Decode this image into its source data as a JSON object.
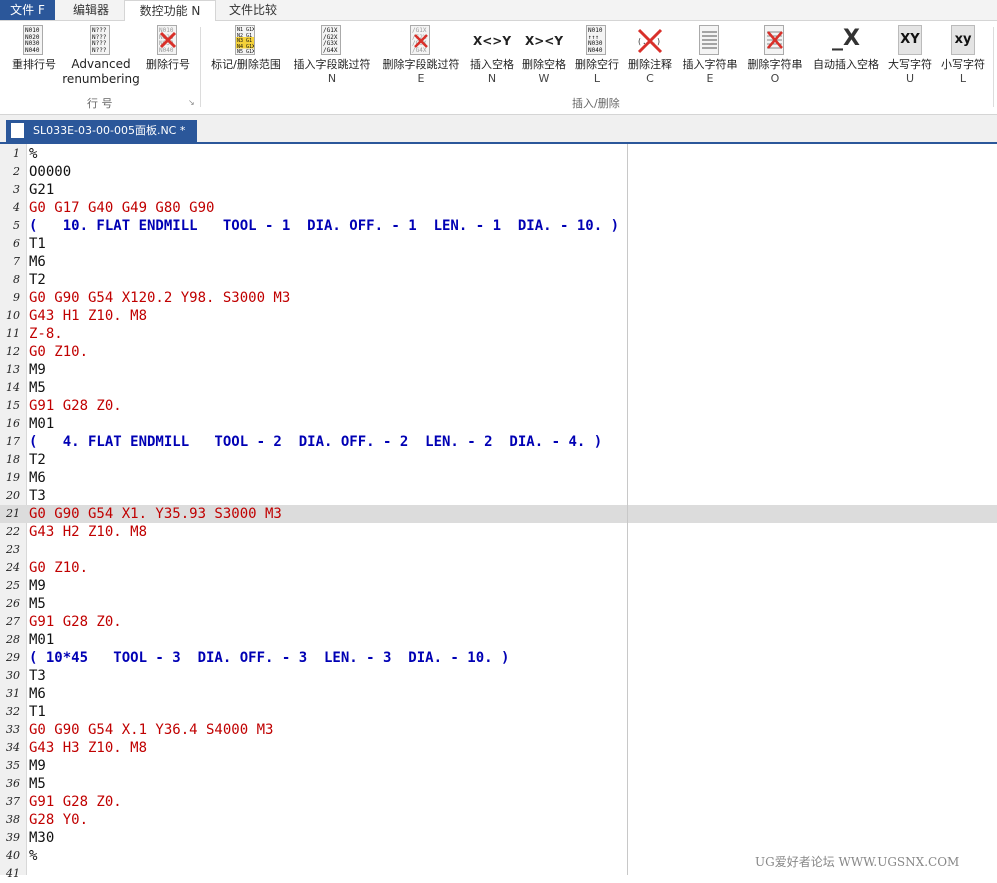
{
  "menubar": {
    "file_label": "文件 F",
    "tabs": [
      "编辑器",
      "数控功能 N",
      "文件比较"
    ]
  },
  "ribbon": {
    "group_line_label": "行 号",
    "group_insert_label": "插入/删除",
    "buttons": [
      {
        "label": "重排行号",
        "key": "",
        "icon": "renumber-icon",
        "icon_text": "N010\nN020\nN030\nN040"
      },
      {
        "label": "Advanced",
        "label2": "renumbering",
        "key": "",
        "icon": "advanced-renumber-icon",
        "icon_text": "N???\nN???\nN???\nN???"
      },
      {
        "label": "删除行号",
        "key": "",
        "icon": "delete-line-number-icon",
        "icon_text": "N010\nN020\nN030\nN040"
      },
      {
        "label": "标记/删除范围",
        "key": "",
        "icon": "mark-range-icon",
        "icon_text": "N1 G1X\nN2 G1\nN3 G1\nN4 G1X\nN5 G1X"
      },
      {
        "label": "插入字段跳过符",
        "key": "N",
        "icon": "insert-block-skip-icon",
        "icon_text": "/G1X\n/G2X\n/G3X\n/G4X"
      },
      {
        "label": "删除字段跳过符",
        "key": "E",
        "icon": "delete-block-skip-icon",
        "icon_text": "/G1X\n/G2X\n/G3X\n/G4X"
      },
      {
        "label": "插入空格",
        "key": "N",
        "icon": "insert-spaces-icon",
        "icon_text": "X<>Y"
      },
      {
        "label": "删除空格",
        "key": "W",
        "icon": "delete-spaces-icon",
        "icon_text": "X><Y"
      },
      {
        "label": "删除空行",
        "key": "L",
        "icon": "delete-empty-lines-icon",
        "icon_text": "N010\n↑↑↑\nN030\nN040"
      },
      {
        "label": "删除注释",
        "key": "C",
        "icon": "delete-comments-icon",
        "icon_text": "(...)"
      },
      {
        "label": "插入字符串",
        "key": "E",
        "icon": "insert-string-icon",
        "icon_text": "STRING"
      },
      {
        "label": "删除字符串",
        "key": "O",
        "icon": "delete-string-icon",
        "icon_text": "STRING"
      },
      {
        "label": "自动插入空格",
        "key": "",
        "icon": "auto-insert-space-icon",
        "icon_text": "_X"
      },
      {
        "label": "大写字符",
        "key": "U",
        "icon": "uppercase-icon",
        "icon_text": "XY"
      },
      {
        "label": "小写字符",
        "key": "L",
        "icon": "lowercase-icon",
        "icon_text": "xy"
      }
    ]
  },
  "editor_tab": {
    "title": "SL033E-03-00-005面板.NC *"
  },
  "highlighted_line": 21,
  "lines": [
    {
      "n": "1",
      "t": "%",
      "c": "black"
    },
    {
      "n": "2",
      "t": "O0000",
      "c": "black"
    },
    {
      "n": "3",
      "t": "G21",
      "c": "black"
    },
    {
      "n": "4",
      "t": "G0 G17 G40 G49 G80 G90",
      "c": "red"
    },
    {
      "n": "5",
      "t": "(   10. FLAT ENDMILL   TOOL - 1  DIA. OFF. - 1  LEN. - 1  DIA. - 10. )",
      "c": "blue"
    },
    {
      "n": "6",
      "t": "T1",
      "c": "black"
    },
    {
      "n": "7",
      "t": "M6",
      "c": "black"
    },
    {
      "n": "8",
      "t": "T2",
      "c": "black"
    },
    {
      "n": "9",
      "t": "G0 G90 G54 X120.2 Y98. S3000 M3",
      "c": "red"
    },
    {
      "n": "10",
      "t": "G43 H1 Z10. M8",
      "c": "red"
    },
    {
      "n": "11",
      "t": "Z-8.",
      "c": "red"
    },
    {
      "n": "12",
      "t": "G0 Z10.",
      "c": "red"
    },
    {
      "n": "13",
      "t": "M9",
      "c": "black"
    },
    {
      "n": "14",
      "t": "M5",
      "c": "black"
    },
    {
      "n": "15",
      "t": "G91 G28 Z0.",
      "c": "red"
    },
    {
      "n": "16",
      "t": "M01",
      "c": "black"
    },
    {
      "n": "17",
      "t": "(   4. FLAT ENDMILL   TOOL - 2  DIA. OFF. - 2  LEN. - 2  DIA. - 4. )",
      "c": "blue"
    },
    {
      "n": "18",
      "t": "T2",
      "c": "black"
    },
    {
      "n": "19",
      "t": "M6",
      "c": "black"
    },
    {
      "n": "20",
      "t": "T3",
      "c": "black"
    },
    {
      "n": "21",
      "t": "G0 G90 G54 X1. Y35.93 S3000 M3",
      "c": "red"
    },
    {
      "n": "22",
      "t": "G43 H2 Z10. M8",
      "c": "red"
    },
    {
      "n": "23",
      "t": "",
      "c": "black"
    },
    {
      "n": "24",
      "t": "G0 Z10.",
      "c": "red"
    },
    {
      "n": "25",
      "t": "M9",
      "c": "black"
    },
    {
      "n": "26",
      "t": "M5",
      "c": "black"
    },
    {
      "n": "27",
      "t": "G91 G28 Z0.",
      "c": "red"
    },
    {
      "n": "28",
      "t": "M01",
      "c": "black"
    },
    {
      "n": "29",
      "t": "( 10*45   TOOL - 3  DIA. OFF. - 3  LEN. - 3  DIA. - 10. )",
      "c": "blue"
    },
    {
      "n": "30",
      "t": "T3",
      "c": "black"
    },
    {
      "n": "31",
      "t": "M6",
      "c": "black"
    },
    {
      "n": "32",
      "t": "T1",
      "c": "black"
    },
    {
      "n": "33",
      "t": "G0 G90 G54 X.1 Y36.4 S4000 M3",
      "c": "red"
    },
    {
      "n": "34",
      "t": "G43 H3 Z10. M8",
      "c": "red"
    },
    {
      "n": "35",
      "t": "M9",
      "c": "black"
    },
    {
      "n": "36",
      "t": "M5",
      "c": "black"
    },
    {
      "n": "37",
      "t": "G91 G28 Z0.",
      "c": "red"
    },
    {
      "n": "38",
      "t": "G28 Y0.",
      "c": "red"
    },
    {
      "n": "39",
      "t": "M30",
      "c": "black"
    },
    {
      "n": "40",
      "t": "%",
      "c": "black"
    },
    {
      "n": "41",
      "t": "",
      "c": "black"
    }
  ],
  "watermark": "UG爱好者论坛 WWW.UGSNX.COM",
  "colors": {
    "accent": "#2b579a",
    "code_red": "#c00000",
    "code_blue": "#0000b4",
    "highlight": "#dcdcdc"
  }
}
